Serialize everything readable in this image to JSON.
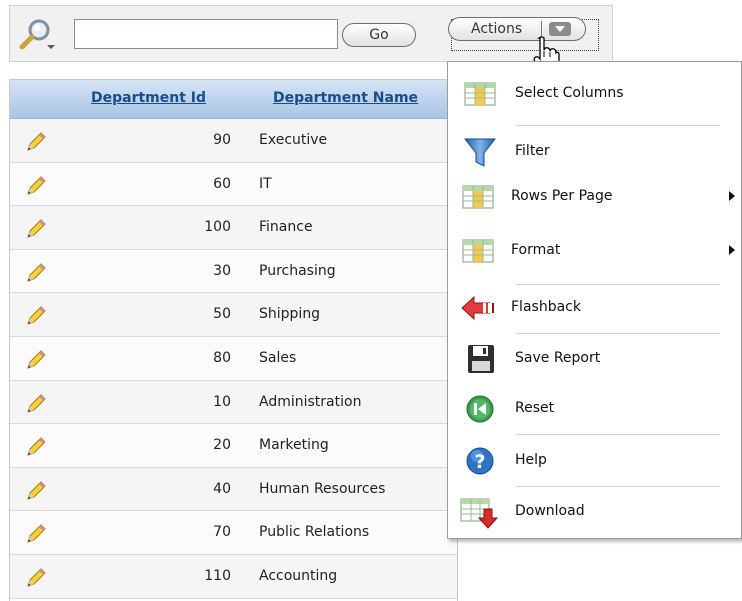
{
  "toolbar": {
    "search_value": "",
    "go_label": "Go",
    "actions_label": "Actions"
  },
  "table": {
    "columns": [
      "Department Id",
      "Department Name"
    ],
    "rows": [
      {
        "id": "90",
        "name": "Executive"
      },
      {
        "id": "60",
        "name": "IT"
      },
      {
        "id": "100",
        "name": "Finance"
      },
      {
        "id": "30",
        "name": "Purchasing"
      },
      {
        "id": "50",
        "name": "Shipping"
      },
      {
        "id": "80",
        "name": "Sales"
      },
      {
        "id": "10",
        "name": "Administration"
      },
      {
        "id": "20",
        "name": "Marketing"
      },
      {
        "id": "40",
        "name": "Human Resources"
      },
      {
        "id": "70",
        "name": "Public Relations"
      },
      {
        "id": "110",
        "name": "Accounting"
      }
    ]
  },
  "menu": {
    "items": [
      {
        "label": "Select Columns",
        "icon": "grid-columns-icon"
      },
      {
        "label": "Filter",
        "icon": "funnel-icon"
      },
      {
        "label": "Rows Per Page",
        "icon": "grid-rows-icon",
        "submenu": true
      },
      {
        "label": "Format",
        "icon": "grid-format-icon",
        "submenu": true
      },
      {
        "label": "Flashback",
        "icon": "flashback-arrow-icon"
      },
      {
        "label": "Save Report",
        "icon": "floppy-disk-icon"
      },
      {
        "label": "Reset",
        "icon": "reset-icon"
      },
      {
        "label": "Help",
        "icon": "help-icon"
      },
      {
        "label": "Download",
        "icon": "download-icon"
      }
    ]
  },
  "colors": {
    "header_gradient_top": "#d4e4f5",
    "header_gradient_bottom": "#a9c5e6",
    "header_link": "#1c4c88"
  }
}
